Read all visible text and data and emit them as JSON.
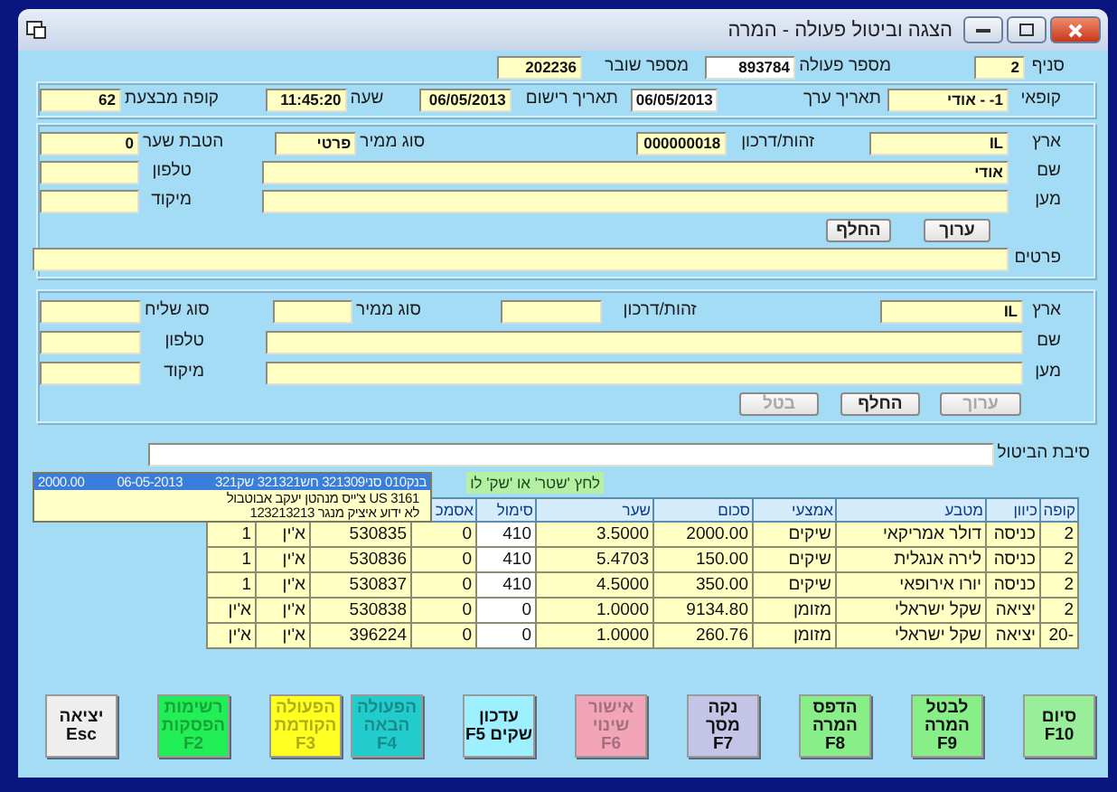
{
  "window": {
    "title": "הצגה וביטול פעולה - המרה"
  },
  "top_fields": [
    {
      "label": "סניף",
      "value": "2",
      "editable": false
    },
    {
      "label": "מספר פעולה",
      "value": "893784",
      "editable": true
    },
    {
      "label": "מספר שובר",
      "value": "202236",
      "editable": false
    }
  ],
  "session": [
    {
      "label": "קופאי",
      "value": "1- - אודי",
      "editable": false
    },
    {
      "label": "תאריך ערך",
      "value": "06/05/2013",
      "editable": true
    },
    {
      "label": "תאריך רישום",
      "value": "06/05/2013",
      "editable": false
    },
    {
      "label": "שעה",
      "value": "11:45:20",
      "editable": false
    },
    {
      "label": "קופה מבצעת",
      "value": "62",
      "editable": false
    }
  ],
  "customer": {
    "fields": [
      {
        "label": "ארץ",
        "value": "IL"
      },
      {
        "label": "זהות/דרכון",
        "value": "000000018"
      },
      {
        "label": "סוג ממיר",
        "value": "פרטי"
      },
      {
        "label": "הטבת שער",
        "value": "0"
      },
      {
        "label": "שם",
        "value": "אודי"
      },
      {
        "label": "טלפון"
      },
      {
        "label": "מען"
      },
      {
        "label": "מיקוד"
      },
      {
        "label": "פרטים"
      }
    ],
    "buttons": [
      {
        "label": "ערוך",
        "disabled": false
      },
      {
        "label": "החלף",
        "disabled": false
      }
    ]
  },
  "recipient": {
    "fields": [
      {
        "label": "ארץ",
        "value": "IL"
      },
      {
        "label": "זהות/דרכון"
      },
      {
        "label": "סוג ממיר"
      },
      {
        "label": "סוג שליח"
      },
      {
        "label": "שם"
      },
      {
        "label": "טלפון"
      },
      {
        "label": "מען"
      },
      {
        "label": "מיקוד"
      }
    ],
    "buttons": [
      {
        "label": "ערוך",
        "disabled": true
      },
      {
        "label": "החלף",
        "disabled": false
      },
      {
        "label": "בטל",
        "disabled": true
      }
    ]
  },
  "cancel_reason": {
    "label": "סיבת הביטול",
    "editable": true
  },
  "hint": "לחץ 'שטר' או 'שק' לו",
  "lookup": [
    {
      "parts": [
        "בנק010 סני321309 חש321321 שק321",
        "06-05-2013",
        "2000.00"
      ],
      "selected": true
    },
    {
      "parts": [
        "3161 US צ'ייס מנהטן יעקב אבוטבול"
      ],
      "selected": false
    },
    {
      "parts": [
        "לא ידוע איציק מנגר 123213213"
      ],
      "selected": false
    }
  ],
  "table": {
    "columns": [
      "קופה",
      "כיוון",
      "מטבע",
      "אמצעי",
      "סכום",
      "שער",
      "סימול",
      "אסמכ"
    ],
    "rows": [
      [
        "2",
        "כניסה",
        "דולר אמריקאי",
        "שיקים",
        "2000.00",
        "3.5000",
        "410",
        "0",
        "530835",
        "א'ין",
        "1"
      ],
      [
        "2",
        "כניסה",
        "לירה אנגלית",
        "שיקים",
        "150.00",
        "5.4703",
        "410",
        "0",
        "530836",
        "א'ין",
        "1"
      ],
      [
        "2",
        "כניסה",
        "יורו אירופאי",
        "שיקים",
        "350.00",
        "4.5000",
        "410",
        "0",
        "530837",
        "א'ין",
        "1"
      ],
      [
        "2",
        "יציאה",
        "שקל ישראלי",
        "מזומן",
        "9134.80",
        "1.0000",
        "0",
        "0",
        "530838",
        "א'ין",
        "א'ין"
      ],
      [
        "-20",
        "יציאה",
        "שקל ישראלי",
        "מזומן",
        "260.76",
        "1.0000",
        "0",
        "0",
        "396224",
        "א'ין",
        "א'ין"
      ]
    ]
  },
  "buttons": [
    {
      "lines": [
        "סיום",
        "F10"
      ],
      "color": "#99ee99",
      "disabled": false
    },
    {
      "lines": [
        "לבטל",
        "המרה F9"
      ],
      "color": "#88ee88",
      "disabled": false
    },
    {
      "lines": [
        "הדפס",
        "המרה F8"
      ],
      "color": "#88ee88",
      "disabled": false
    },
    {
      "lines": [
        "נקה מסך",
        "F7"
      ],
      "color": "#c4c4e6",
      "disabled": false
    },
    {
      "lines": [
        "אישור",
        "שינוי",
        "F6"
      ],
      "color": "#f2a4b8",
      "disabled": true
    },
    {
      "lines": [
        "עדכון",
        "שקים F5"
      ],
      "color": "#9ef0ff",
      "disabled": false
    },
    {
      "lines": [
        "הפעולה",
        "הבאה",
        "F4"
      ],
      "color": "#22cccc",
      "disabled": true
    },
    {
      "lines": [
        "הפעולה",
        "הקודמת",
        "F3"
      ],
      "color": "#ffff22",
      "disabled": true
    },
    {
      "lines": [
        "רשימות",
        "הפסקות",
        "F2"
      ],
      "color": "#22ee55",
      "disabled": true
    },
    {
      "lines": [
        "יציאה",
        "Esc"
      ],
      "color": "#eeeeee",
      "disabled": false
    }
  ]
}
